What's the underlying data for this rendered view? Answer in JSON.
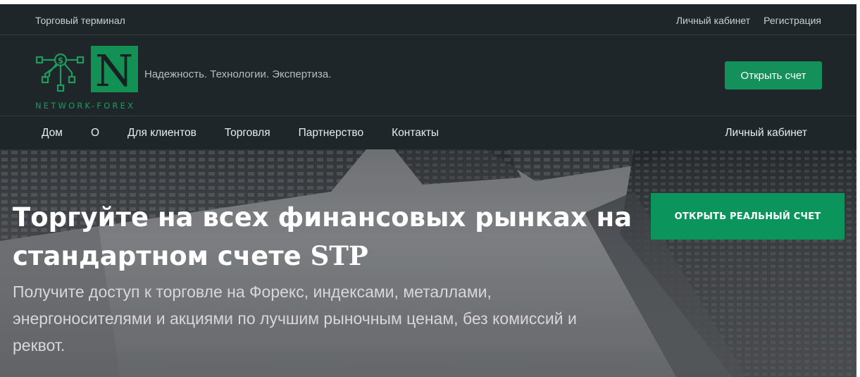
{
  "topbar": {
    "left_link": "Торговый терминал",
    "right_links": [
      "Личный кабинет",
      "Регистрация"
    ]
  },
  "header": {
    "logo_letter": "N",
    "logo_text": "NETWORK-FOREX",
    "tagline": "Надежность. Технологии. Экспертиза.",
    "open_account_label": "Открыть счет",
    "brand_color": "#14915a"
  },
  "nav": {
    "items": [
      "Дом",
      "О",
      "Для клиентов",
      "Торговля",
      "Партнерство",
      "Контакты"
    ],
    "right_item": "Личный кабинет"
  },
  "hero": {
    "title_main": "Торгуйте на всех финансовых рынках на стандартном счете ",
    "title_suffix": "STP",
    "subtitle": "Получите доступ к торговле на Форекс, индексами, металлами, энергоносителями и акциями по лучшим рыночным ценам, без комиссий и реквот.",
    "cta_label": "ОТКРЫТЬ РЕАЛЬНЫЙ СЧЕТ",
    "background_icon": "skyscrapers-image"
  }
}
